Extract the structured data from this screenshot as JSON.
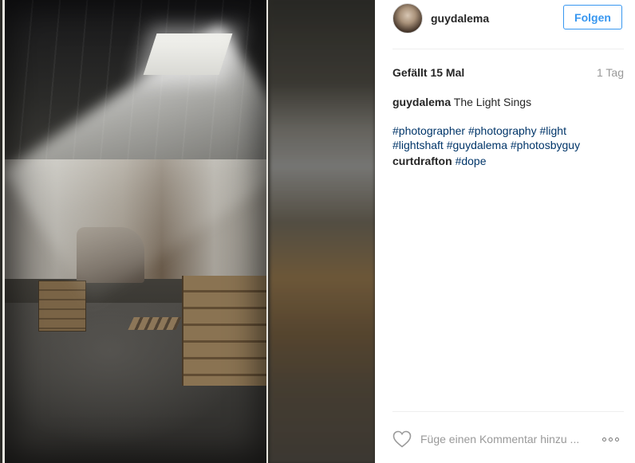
{
  "post": {
    "username": "guydalema",
    "follow_label": "Folgen",
    "likes": "Gefällt 15 Mal",
    "time_ago": "1 Tag"
  },
  "comments": [
    {
      "user": "guydalema",
      "text": "The Light Sings",
      "tags_line1": [
        "#photographer",
        "#photography",
        "#light"
      ],
      "tags_line2": [
        "#lightshaft",
        "#guydalema",
        "#photosbyguy"
      ]
    },
    {
      "user": "curtdrafton",
      "tags": [
        "#dope"
      ]
    }
  ],
  "add_comment": {
    "placeholder": "Füge einen Kommentar hinzu ..."
  },
  "icons": {
    "like": "heart-icon",
    "more": "more-options-icon"
  },
  "colors": {
    "accent": "#3897f0",
    "hashtag": "#003569",
    "muted": "#999999"
  }
}
